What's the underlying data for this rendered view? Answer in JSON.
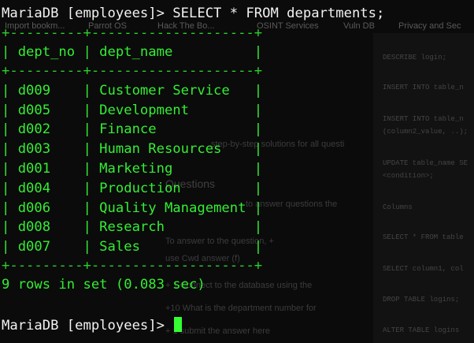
{
  "background": {
    "bookmarks": [
      "Import bookm...",
      "Parrot OS",
      "Hack The Bo...",
      "OSINT Services",
      "Vuln DB",
      "Privacy and Sec"
    ],
    "right_panel": [
      "DESCRIBE login;",
      "INSERT INTO table_n",
      "INSERT INTO table_n",
      "(column2_value, ..);",
      "UPDATE table_name SE",
      "<condition>;",
      "Columns",
      "SELECT * FROM table",
      "SELECT column1, col",
      "DROP TABLE logins;",
      "ALTER TABLE logins"
    ],
    "mid_text": [
      "step-by-step solutions for all questi",
      "Questions",
      "to answer questions the",
      "To answer to the question, +",
      "use Cwd answer (f)",
      "+ 1 Connect to the database using the",
      "+10  What is the department number for",
      "+ 1 submit the answer here"
    ]
  },
  "terminal": {
    "command_prompt": "MariaDB [employees]> SELECT * FROM departments;",
    "border": "+---------+--------------------+",
    "header": "| dept_no | dept_name          |",
    "rows": [
      "| d009    | Customer Service   |",
      "| d005    | Development        |",
      "| d002    | Finance            |",
      "| d003    | Human Resources    |",
      "| d001    | Marketing          |",
      "| d004    | Production         |",
      "| d006    | Quality Management |",
      "| d008    | Research           |",
      "| d007    | Sales              |"
    ],
    "summary": "9 rows in set (0.083 sec)",
    "final_prompt": "MariaDB [employees]> "
  }
}
